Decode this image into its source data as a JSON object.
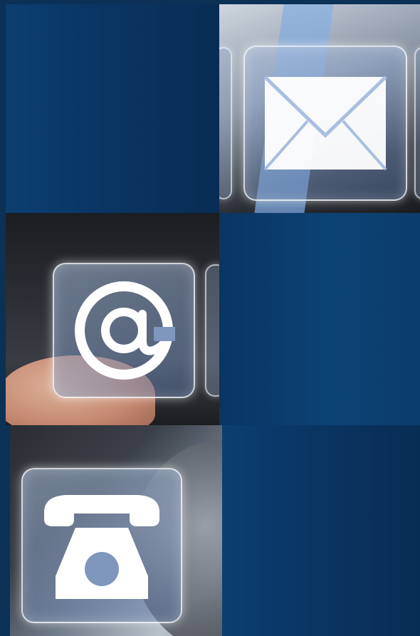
{
  "icons": {
    "envelope": "envelope-icon",
    "at_sign": "at-sign-icon",
    "telephone": "telephone-icon"
  },
  "colors": {
    "background": "#0b3157",
    "blue_tile": "#0a3563",
    "glass": "#8fa6c8",
    "glyph": "#ffffff"
  }
}
